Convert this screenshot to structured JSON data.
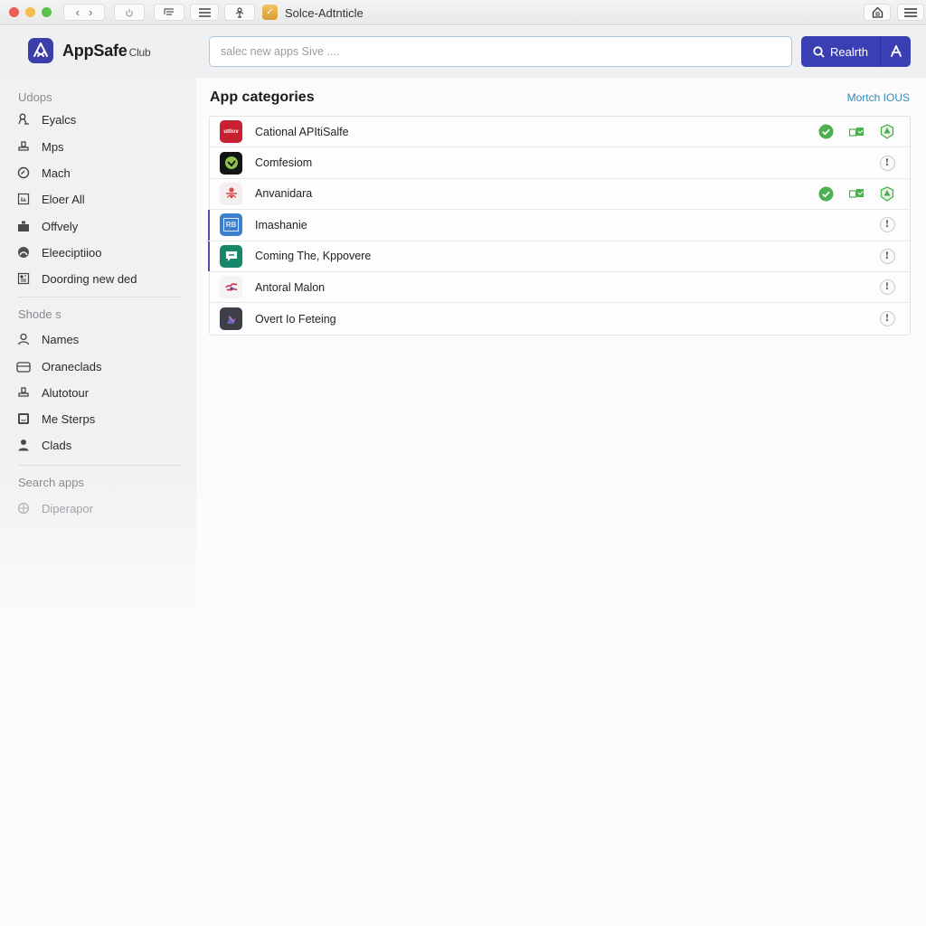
{
  "window": {
    "tab_title": "Solce-Adtnticle",
    "nav_back": "‹",
    "nav_forward": "›"
  },
  "header": {
    "logo_name": "AppSafe",
    "logo_suffix": "Club",
    "search_placeholder": "salec new apps Sive ....",
    "search_value": "",
    "search_button_label": "Realrth"
  },
  "sidebar": {
    "sections": [
      {
        "title": "Udops",
        "items": [
          {
            "label": "Eyalcs",
            "icon": "user-badge-icon"
          },
          {
            "label": "Mps",
            "icon": "stamp-icon"
          },
          {
            "label": "Mach",
            "icon": "clock-icon"
          },
          {
            "label": "Eloer All",
            "icon": "chart-box-icon"
          },
          {
            "label": "Offvely",
            "icon": "gift-box-icon"
          },
          {
            "label": "Eleeciptiioo",
            "icon": "dome-icon"
          },
          {
            "label": "Doording new ded",
            "icon": "grid-board-icon"
          }
        ]
      },
      {
        "title": "Shode s",
        "items": [
          {
            "label": "Names",
            "icon": "person-icon"
          },
          {
            "label": "Oraneclads",
            "icon": "briefcase-icon"
          },
          {
            "label": "Alutotour",
            "icon": "stamp-icon"
          },
          {
            "label": "Me Sterps",
            "icon": "face-frame-icon"
          },
          {
            "label": "Clads",
            "icon": "user-filled-icon"
          }
        ]
      },
      {
        "title": "Search apps",
        "items": [
          {
            "label": "Diperapor",
            "icon": "globe-icon",
            "muted": true
          }
        ]
      }
    ]
  },
  "main": {
    "title": "App categories",
    "link_label": "Mortch IOUS",
    "apps": [
      {
        "name": "Cational APItiSalfe",
        "icon_text": "uttiov",
        "icon_color": "#c8202f",
        "status": "verified"
      },
      {
        "name": "Comfesiom",
        "icon_text": "",
        "icon_color": "#141414",
        "status": "info"
      },
      {
        "name": "Anvanidara",
        "icon_text": "",
        "icon_color": "#f5eeee",
        "status": "verified"
      },
      {
        "name": "Imashanie",
        "icon_text": "RB",
        "icon_color": "#3c7fd0",
        "status": "info",
        "accent": true
      },
      {
        "name": "Coming The, Kppovere",
        "icon_text": "",
        "icon_color": "#17876a",
        "status": "info",
        "accent": true
      },
      {
        "name": "Antoral Malon",
        "icon_text": "",
        "icon_color": "#f6f3f3",
        "status": "info"
      },
      {
        "name": "Overt Io Feteing",
        "icon_text": "",
        "icon_color": "#3e3f46",
        "status": "info"
      }
    ],
    "info_glyph": "!"
  },
  "colors": {
    "accent": "#3a3fb3",
    "verified_green": "#4caf50",
    "link": "#3a89b8"
  }
}
